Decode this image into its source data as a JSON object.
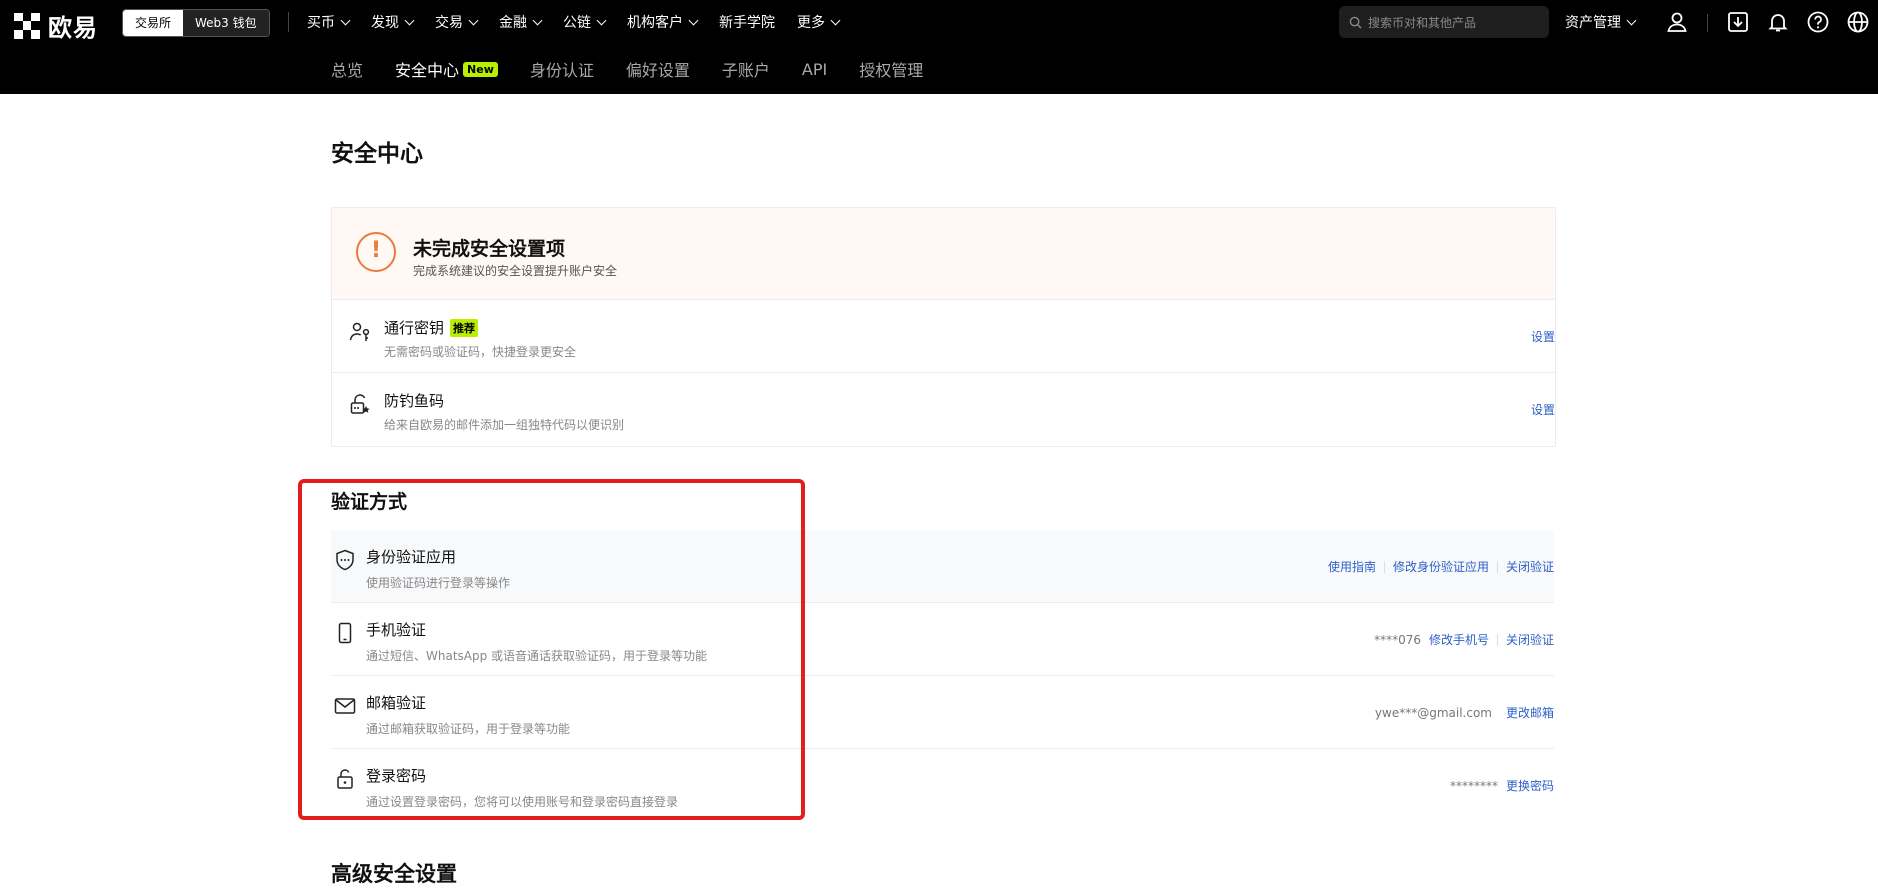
{
  "brand": {
    "name": "欧易"
  },
  "switcher": {
    "exchange": "交易所",
    "wallet": "Web3 钱包"
  },
  "menu": [
    "买币",
    "发现",
    "交易",
    "金融",
    "公链",
    "机构客户",
    "新手学院",
    "更多"
  ],
  "search": {
    "placeholder": "搜索币对和其他产品"
  },
  "assets_label": "资产管理",
  "subnav": {
    "items": [
      "总览",
      "安全中心",
      "身份认证",
      "偏好设置",
      "子账户",
      "API",
      "授权管理"
    ],
    "active": "安全中心",
    "new_badge": "New"
  },
  "page_title": "安全中心",
  "warning": {
    "title": "未完成安全设置项",
    "subtitle": "完成系统建议的安全设置提升账户安全",
    "items": [
      {
        "icon": "passkey-icon",
        "title": "通行密钥",
        "badge": "推荐",
        "desc": "无需密码或验证码，快捷登录更安全",
        "action": "设置"
      },
      {
        "icon": "anti-phishing-icon",
        "title": "防钓鱼码",
        "desc": "给来自欧易的邮件添加一组独特代码以便识别",
        "action": "设置"
      }
    ]
  },
  "verification": {
    "title": "验证方式",
    "items": [
      {
        "icon": "authenticator-shield-icon",
        "title": "身份验证应用",
        "desc": "使用验证码进行登录等操作",
        "value": "",
        "actions": [
          "使用指南",
          "修改身份验证应用",
          "关闭验证"
        ]
      },
      {
        "icon": "phone-icon",
        "title": "手机验证",
        "desc": "通过短信、WhatsApp 或语音通话获取验证码，用于登录等功能",
        "value": "****076",
        "actions": [
          "修改手机号",
          "关闭验证"
        ]
      },
      {
        "icon": "mail-icon",
        "title": "邮箱验证",
        "desc": "通过邮箱获取验证码，用于登录等功能",
        "value": "ywe***@gmail.com",
        "actions": [
          "更改邮箱"
        ]
      },
      {
        "icon": "lock-icon",
        "title": "登录密码",
        "desc": "通过设置登录密码，您将可以使用账号和登录密码直接登录",
        "value": "********",
        "actions": [
          "更换密码"
        ]
      }
    ]
  },
  "advanced_title": "高级安全设置",
  "colors": {
    "accent_link": "#2e60c8",
    "badge_green": "#b7f000",
    "warn_orange": "#ea7b3c",
    "highlight_red": "#e41d1d"
  }
}
